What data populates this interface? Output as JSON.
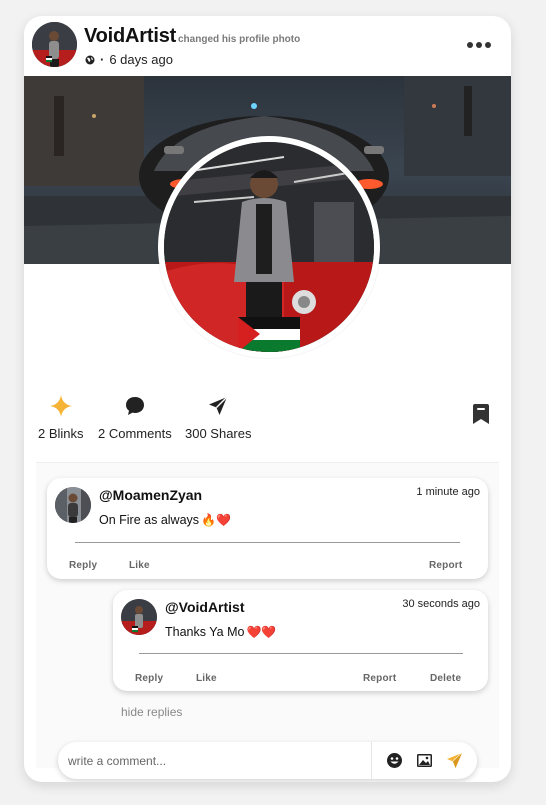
{
  "post": {
    "username": "VoidArtist",
    "action_text": "changed his profile photo",
    "timestamp": "6 days ago",
    "dot": "·"
  },
  "actions": {
    "blinks_label": "2 Blinks",
    "comments_label": "2 Comments",
    "shares_label": "300 Shares"
  },
  "comments": [
    {
      "author": "@MoamenZyan",
      "time": "1 minute ago",
      "text": "On Fire as always",
      "emojis": "🔥❤️",
      "reply_label": "Reply",
      "like_label": "Like",
      "report_label": "Report"
    }
  ],
  "replies": [
    {
      "author": "@VoidArtist",
      "time": "30 seconds ago",
      "text": "Thanks Ya Mo",
      "emojis": "❤️❤️",
      "reply_label": "Reply",
      "like_label": "Like",
      "report_label": "Report",
      "delete_label": "Delete"
    }
  ],
  "hide_replies_label": "hide replies",
  "compose": {
    "placeholder": "write a comment...",
    "value": ""
  },
  "colors": {
    "accent_star": "#f5b436",
    "accent_send": "#f5b436",
    "icon_dark": "#222222"
  },
  "icons": {
    "more": "ellipsis-icon",
    "globe": "globe-icon",
    "blink": "sparkle-icon",
    "comment": "chat-bubble-icon",
    "share": "send-arrow-icon",
    "bookmark": "bookmark-icon",
    "emoji": "smiley-icon",
    "image": "image-icon",
    "send": "send-icon"
  }
}
